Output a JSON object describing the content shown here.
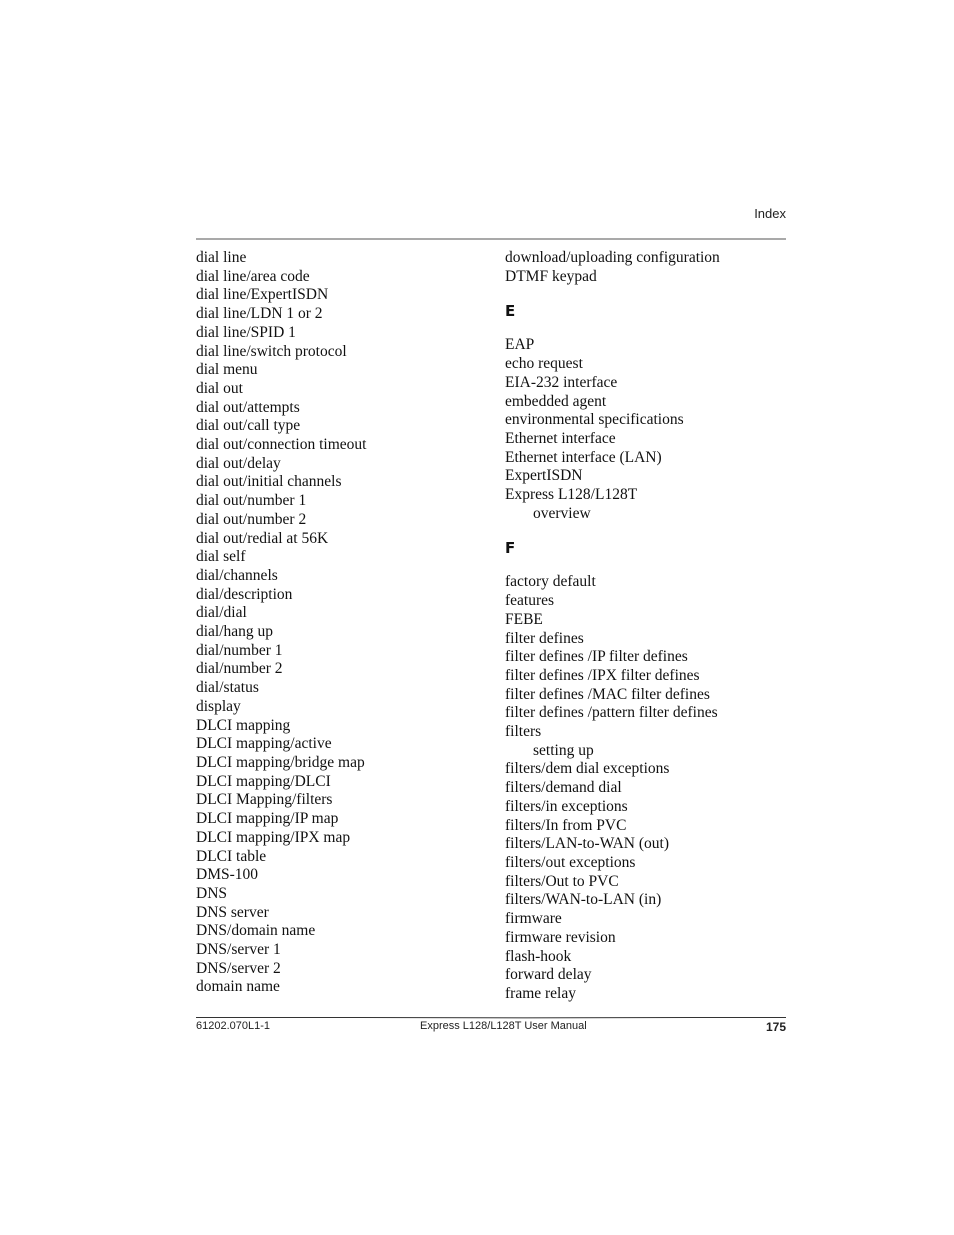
{
  "header": {
    "section": "Index"
  },
  "left_column": [
    {
      "text": "dial line",
      "sub": false
    },
    {
      "text": "dial line/area code",
      "sub": false
    },
    {
      "text": "dial line/ExpertISDN",
      "sub": false
    },
    {
      "text": "dial line/LDN 1 or 2",
      "sub": false
    },
    {
      "text": "dial line/SPID 1",
      "sub": false
    },
    {
      "text": "dial line/switch protocol",
      "sub": false
    },
    {
      "text": "dial menu",
      "sub": false
    },
    {
      "text": "dial out",
      "sub": false
    },
    {
      "text": "dial out/attempts",
      "sub": false
    },
    {
      "text": "dial out/call type",
      "sub": false
    },
    {
      "text": "dial out/connection timeout",
      "sub": false
    },
    {
      "text": "dial out/delay",
      "sub": false
    },
    {
      "text": "dial out/initial channels",
      "sub": false
    },
    {
      "text": "dial out/number 1",
      "sub": false
    },
    {
      "text": "dial out/number 2",
      "sub": false
    },
    {
      "text": "dial out/redial at 56K",
      "sub": false
    },
    {
      "text": "dial self",
      "sub": false
    },
    {
      "text": "dial/channels",
      "sub": false
    },
    {
      "text": "dial/description",
      "sub": false
    },
    {
      "text": "dial/dial",
      "sub": false
    },
    {
      "text": "dial/hang up",
      "sub": false
    },
    {
      "text": "dial/number 1",
      "sub": false
    },
    {
      "text": "dial/number 2",
      "sub": false
    },
    {
      "text": "dial/status",
      "sub": false
    },
    {
      "text": "display",
      "sub": false
    },
    {
      "text": "DLCI mapping",
      "sub": false
    },
    {
      "text": "DLCI mapping/active",
      "sub": false
    },
    {
      "text": "DLCI mapping/bridge map",
      "sub": false
    },
    {
      "text": "DLCI mapping/DLCI",
      "sub": false
    },
    {
      "text": "DLCI Mapping/filters",
      "sub": false
    },
    {
      "text": "DLCI mapping/IP map",
      "sub": false
    },
    {
      "text": "DLCI mapping/IPX map",
      "sub": false
    },
    {
      "text": "DLCI table",
      "sub": false
    },
    {
      "text": "DMS-100",
      "sub": false
    },
    {
      "text": "DNS",
      "sub": false
    },
    {
      "text": "DNS server",
      "sub": false
    },
    {
      "text": "DNS/domain name",
      "sub": false
    },
    {
      "text": "DNS/server 1",
      "sub": false
    },
    {
      "text": "DNS/server 2",
      "sub": false
    },
    {
      "text": "domain name",
      "sub": false
    }
  ],
  "right_column": {
    "lead": [
      {
        "text": "download/uploading configuration",
        "sub": false
      },
      {
        "text": "DTMF keypad",
        "sub": false
      }
    ],
    "sections": [
      {
        "letter": "E",
        "entries": [
          {
            "text": "EAP",
            "sub": false
          },
          {
            "text": "echo request",
            "sub": false
          },
          {
            "text": "EIA-232 interface",
            "sub": false
          },
          {
            "text": "embedded agent",
            "sub": false
          },
          {
            "text": "environmental specifications",
            "sub": false
          },
          {
            "text": "Ethernet interface",
            "sub": false
          },
          {
            "text": "Ethernet interface (LAN)",
            "sub": false
          },
          {
            "text": "ExpertISDN",
            "sub": false
          },
          {
            "text": "Express L128/L128T",
            "sub": false
          },
          {
            "text": "overview",
            "sub": true
          }
        ]
      },
      {
        "letter": "F",
        "entries": [
          {
            "text": "factory default",
            "sub": false
          },
          {
            "text": "features",
            "sub": false
          },
          {
            "text": "FEBE",
            "sub": false
          },
          {
            "text": "filter defines",
            "sub": false
          },
          {
            "text": "filter defines /IP filter defines",
            "sub": false
          },
          {
            "text": "filter defines /IPX filter defines",
            "sub": false
          },
          {
            "text": "filter defines /MAC filter defines",
            "sub": false
          },
          {
            "text": "filter defines /pattern filter defines",
            "sub": false
          },
          {
            "text": "filters",
            "sub": false
          },
          {
            "text": "setting up",
            "sub": true
          },
          {
            "text": "filters/dem dial exceptions",
            "sub": false
          },
          {
            "text": "filters/demand dial",
            "sub": false
          },
          {
            "text": "filters/in exceptions",
            "sub": false
          },
          {
            "text": "filters/In from PVC",
            "sub": false
          },
          {
            "text": "filters/LAN-to-WAN (out)",
            "sub": false
          },
          {
            "text": "filters/out exceptions",
            "sub": false
          },
          {
            "text": "filters/Out to PVC",
            "sub": false
          },
          {
            "text": "filters/WAN-to-LAN (in)",
            "sub": false
          },
          {
            "text": "firmware",
            "sub": false
          },
          {
            "text": "firmware revision",
            "sub": false
          },
          {
            "text": "flash-hook",
            "sub": false
          },
          {
            "text": "forward delay",
            "sub": false
          },
          {
            "text": "frame relay",
            "sub": false
          }
        ]
      }
    ]
  },
  "footer": {
    "doc_number": "61202.070L1-1",
    "title": "Express L128/L128T User Manual",
    "page_number": "175"
  }
}
